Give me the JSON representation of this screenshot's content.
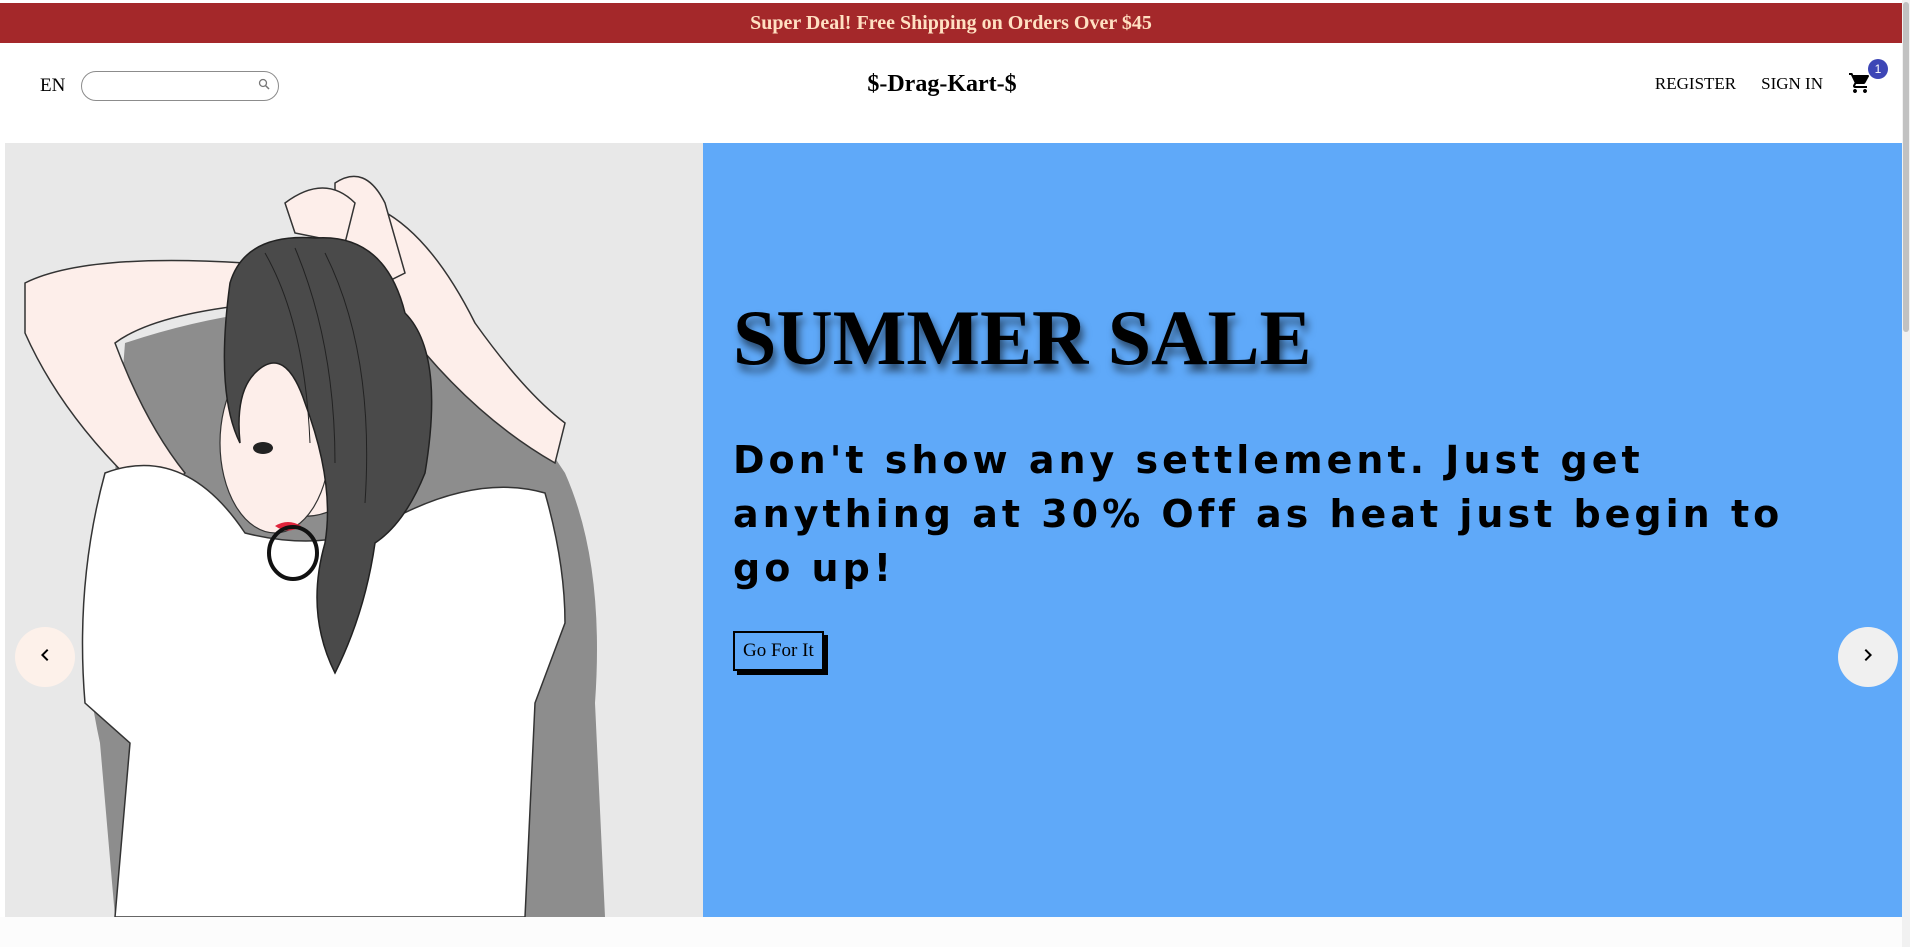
{
  "announcement": {
    "text": "Super Deal! Free Shipping on Orders Over $45"
  },
  "navbar": {
    "language": "EN",
    "search": {
      "value": "",
      "placeholder": ""
    },
    "logo": "$-Drag-Kart-$",
    "links": {
      "register": "REGISTER",
      "sign_in": "SIGN IN"
    },
    "cart_count": "1"
  },
  "slider": {
    "slide": {
      "image_icon": "woman-illustration",
      "background_color": "#5fa9f9",
      "title": "SUMMER SALE",
      "description": "Don't show any settlement. Just get anything at 30% Off as heat just begin to go up!",
      "button_label": "Go For It"
    },
    "prev_icon": "chevron-left-icon",
    "next_icon": "chevron-right-icon"
  },
  "colors": {
    "announcement_bg": "#a4282a",
    "announcement_text": "#ffe0c2",
    "badge": "#3d46b6",
    "slide_image_bg": "#e8e8e8"
  }
}
